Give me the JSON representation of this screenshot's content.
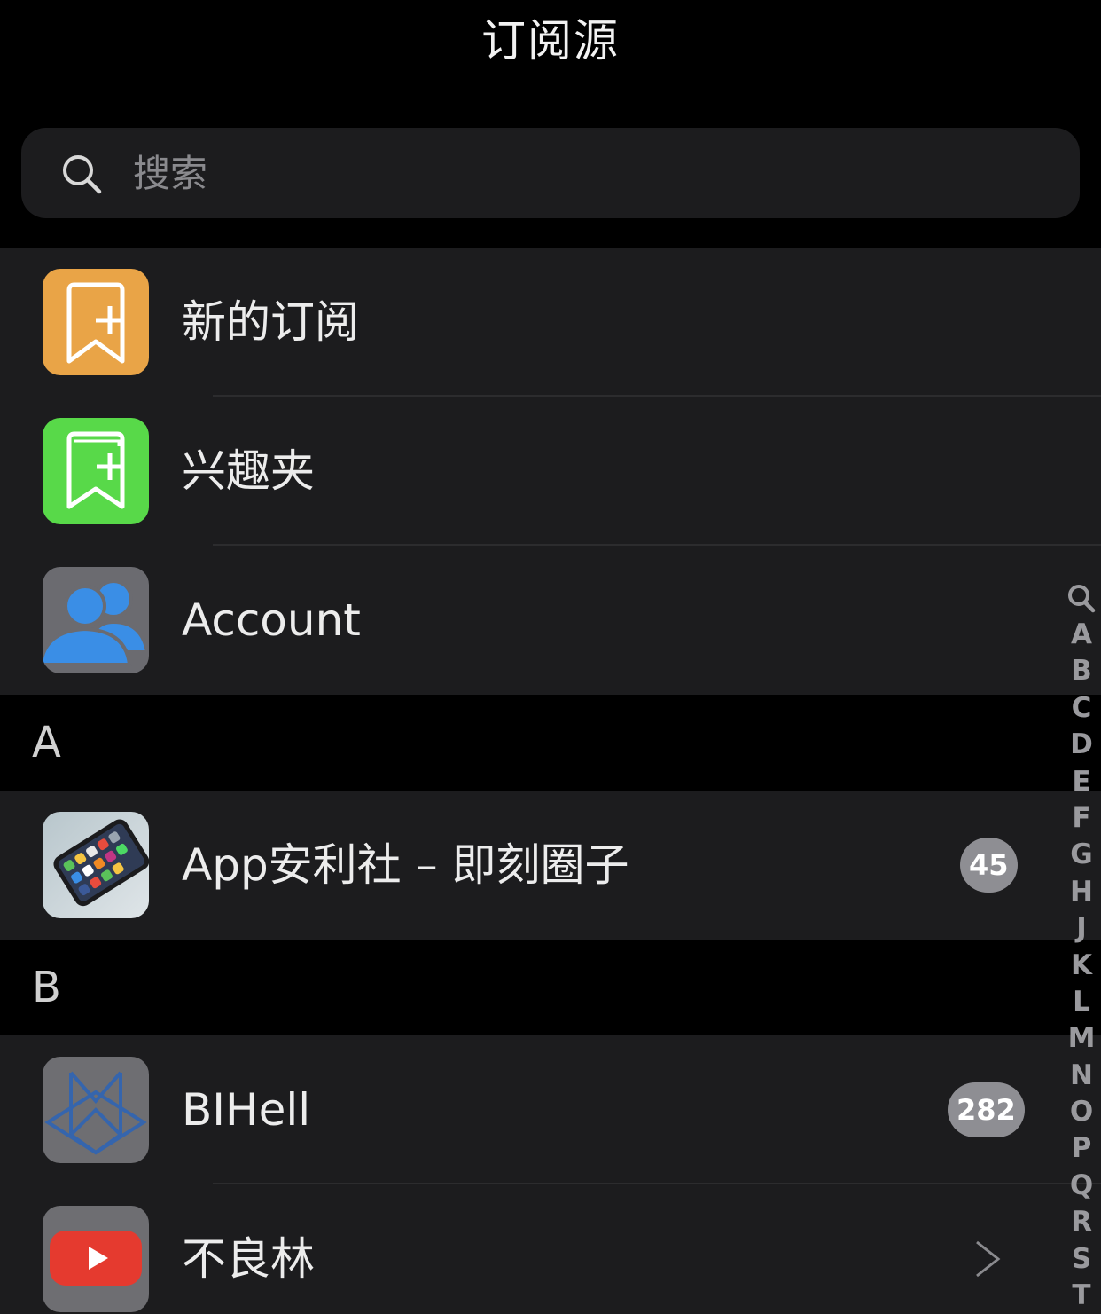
{
  "header": {
    "title": "订阅源"
  },
  "search": {
    "placeholder": "搜索"
  },
  "top_items": [
    {
      "label": "新的订阅",
      "icon": "bookmark-plus-icon",
      "color": "#e9a447"
    },
    {
      "label": "兴趣夹",
      "icon": "bookmark-plus-icon",
      "color": "#58d949"
    },
    {
      "label": "Account",
      "icon": "contacts-icon",
      "color": "#6b6b70"
    }
  ],
  "sections": [
    {
      "letter": "A",
      "items": [
        {
          "label": "App安利社 – 即刻圈子",
          "badge": "45"
        }
      ]
    },
    {
      "letter": "B",
      "items": [
        {
          "label": "BIHell",
          "badge": "282"
        },
        {
          "label": "不良林"
        }
      ]
    }
  ],
  "index": [
    "A",
    "B",
    "C",
    "D",
    "E",
    "F",
    "G",
    "H",
    "J",
    "K",
    "L",
    "M",
    "N",
    "O",
    "P",
    "Q",
    "R",
    "S",
    "T"
  ],
  "colors": {
    "badge": "#8e8e93",
    "row_bg": "#1c1c1e",
    "accent_blue": "#3a8ee6"
  }
}
